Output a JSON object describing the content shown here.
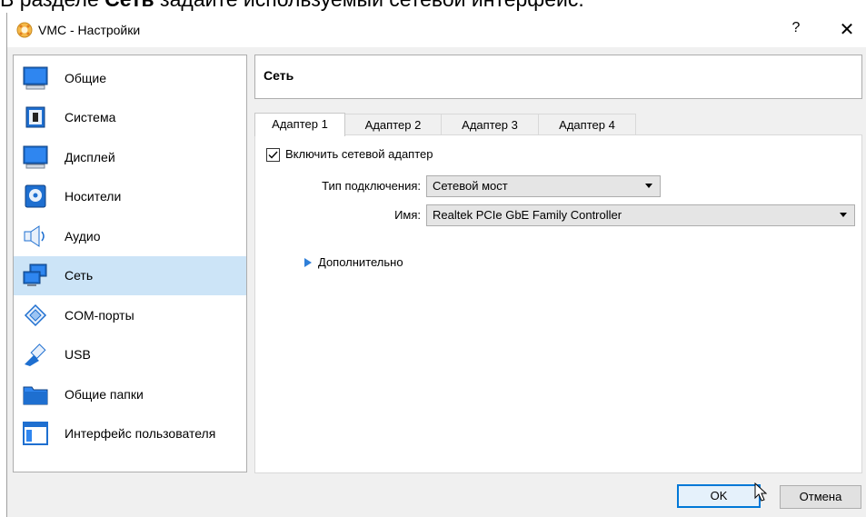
{
  "caption": {
    "prefix": "В разделе ",
    "bold": "Сеть",
    "suffix": " задайте используемый сетевой интерфейс."
  },
  "window": {
    "title": "VMC - Настройки",
    "help": "?",
    "close": "✕"
  },
  "sidebar": {
    "items": [
      {
        "label": "Общие",
        "icon": "monitor-icon"
      },
      {
        "label": "Система",
        "icon": "chip-icon"
      },
      {
        "label": "Дисплей",
        "icon": "display-icon"
      },
      {
        "label": "Носители",
        "icon": "disk-icon"
      },
      {
        "label": "Аудио",
        "icon": "speaker-icon"
      },
      {
        "label": "Сеть",
        "icon": "network-icon",
        "selected": true
      },
      {
        "label": "COM-порты",
        "icon": "serial-port-icon"
      },
      {
        "label": "USB",
        "icon": "usb-icon"
      },
      {
        "label": "Общие папки",
        "icon": "folder-icon"
      },
      {
        "label": "Интерфейс пользователя",
        "icon": "window-ui-icon"
      }
    ]
  },
  "header": {
    "title": "Сеть"
  },
  "tabs": [
    {
      "label": "Адаптер 1",
      "active": true
    },
    {
      "label": "Адаптер 2"
    },
    {
      "label": "Адаптер 3"
    },
    {
      "label": "Адаптер 4"
    }
  ],
  "adapter": {
    "enable_label": "Включить сетевой адаптер",
    "enabled": true,
    "attachment_label": "Тип подключения:",
    "attachment_value": "Сетевой мост",
    "name_label": "Имя:",
    "name_value": "Realtek PCIe GbE Family Controller",
    "advanced_label": "Дополнительно"
  },
  "buttons": {
    "ok": "OK",
    "cancel": "Отмена"
  },
  "colors": {
    "selection": "#cce4f7",
    "accent": "#0078d7"
  }
}
